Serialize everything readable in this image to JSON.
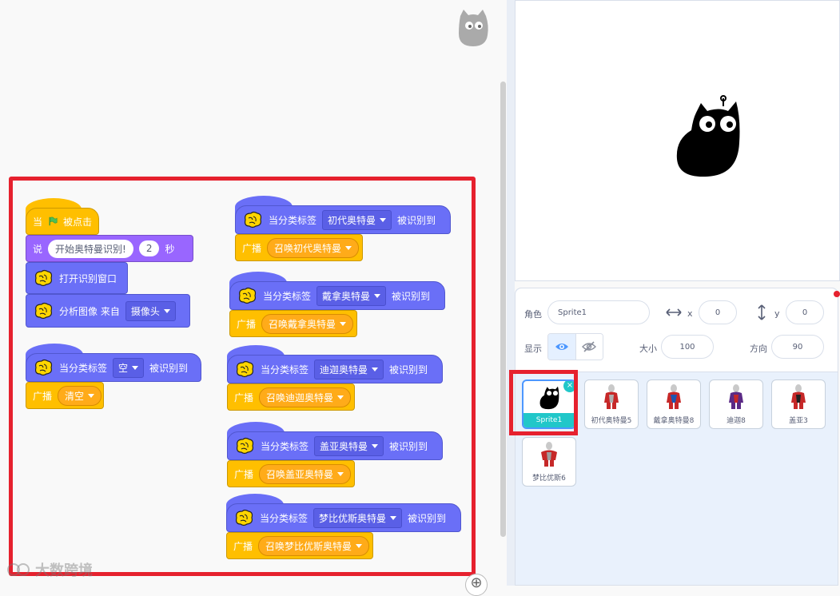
{
  "workspace": {
    "script1": {
      "hat": {
        "when": "当",
        "clicked": "被点击"
      },
      "say": {
        "label": "说",
        "text": "开始奥特曼识别!",
        "secs": "2",
        "unit": "秒"
      },
      "open_window": "打开识别窗口",
      "analyze": {
        "label": "分析图像 来自",
        "source": "摄像头"
      }
    },
    "script2": {
      "hat": {
        "prefix": "当分类标签",
        "value": "空",
        "suffix": "被识别到"
      },
      "broadcast": {
        "label": "广播",
        "value": "清空"
      }
    },
    "right_scripts": [
      {
        "prefix": "当分类标签",
        "value": "初代奥特曼",
        "suffix": "被识别到",
        "broadcast_label": "广播",
        "broadcast_value": "召唤初代奥特曼"
      },
      {
        "prefix": "当分类标签",
        "value": "戴拿奥特曼",
        "suffix": "被识别到",
        "broadcast_label": "广播",
        "broadcast_value": "召唤戴拿奥特曼"
      },
      {
        "prefix": "当分类标签",
        "value": "迪迦奥特曼",
        "suffix": "被识别到",
        "broadcast_label": "广播",
        "broadcast_value": "召唤迪迦奥特曼"
      },
      {
        "prefix": "当分类标签",
        "value": "盖亚奥特曼",
        "suffix": "被识别到",
        "broadcast_label": "广播",
        "broadcast_value": "召唤盖亚奥特曼"
      },
      {
        "prefix": "当分类标签",
        "value": "梦比优斯奥特曼",
        "suffix": "被识别到",
        "broadcast_label": "广播",
        "broadcast_value": "召唤梦比优斯奥特曼"
      }
    ],
    "zoom_in": "⊕"
  },
  "sprite_info": {
    "sprite_label": "角色",
    "sprite_name": "Sprite1",
    "x_label": "x",
    "x_value": "0",
    "y_label": "y",
    "y_value": "0",
    "show_label": "显示",
    "size_label": "大小",
    "size_value": "100",
    "direction_label": "方向",
    "direction_value": "90"
  },
  "sprites": [
    {
      "name": "Sprite1",
      "selected": true
    },
    {
      "name": "初代奥特曼5"
    },
    {
      "name": "戴拿奥特曼8"
    },
    {
      "name": "迪迦8"
    },
    {
      "name": "盖亚3"
    },
    {
      "name": "梦比优斯6"
    }
  ],
  "watermark": "大数跨境",
  "colors": {
    "events": "#ffbf00",
    "looks": "#9966ff",
    "extension": "#6a6ff7",
    "highlight": "#e6212e",
    "selected": "#21c7c9"
  }
}
